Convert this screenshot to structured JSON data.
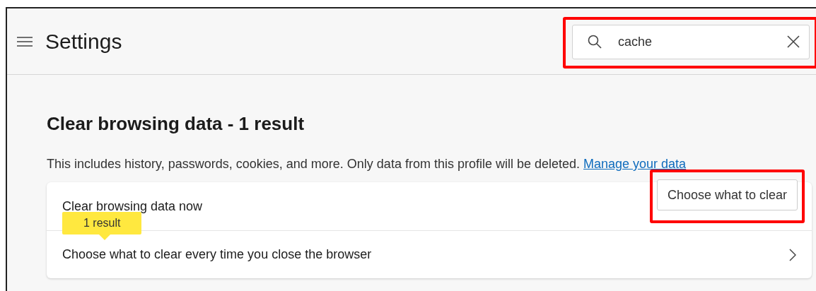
{
  "header": {
    "title": "Settings",
    "search": {
      "value": "cache",
      "highlighted": true
    }
  },
  "section": {
    "title": "Clear browsing data - 1 result",
    "description": "This includes history, passwords, cookies, and more. Only data from this profile will be deleted.",
    "link": "Manage your data"
  },
  "rows": [
    {
      "kind": "button",
      "label": "Clear browsing data now",
      "button": "Choose what to clear",
      "highlighted": true,
      "result_tip": "1 result"
    },
    {
      "kind": "chevron",
      "label": "Choose what to clear every time you close the browser"
    }
  ]
}
